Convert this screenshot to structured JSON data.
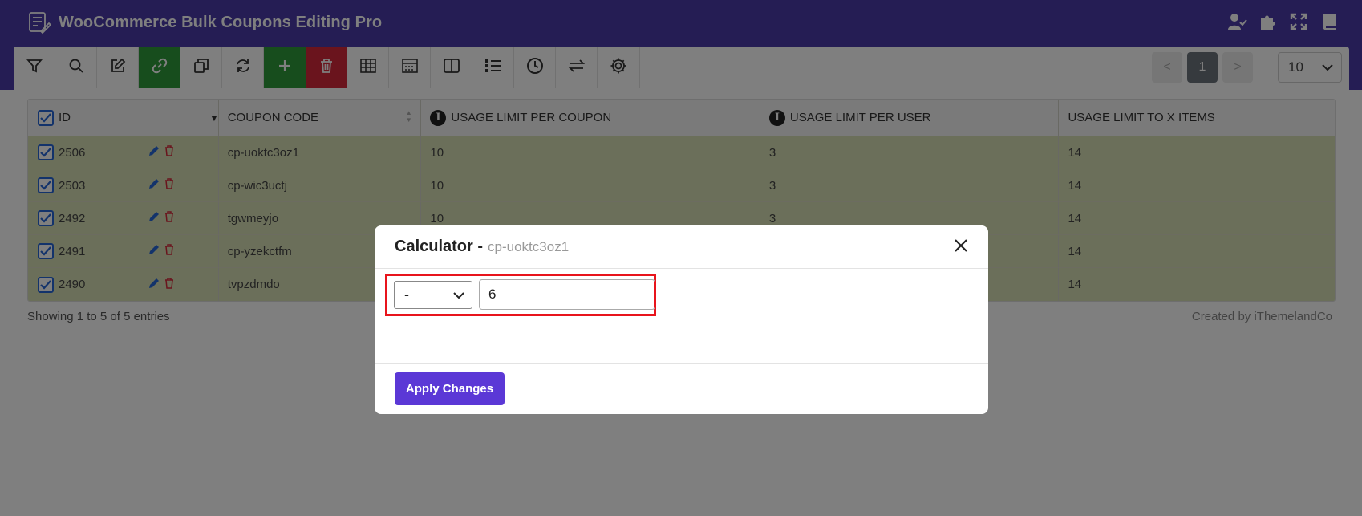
{
  "app": {
    "title": "WooCommerce Bulk Coupons Editing Pro"
  },
  "header_icons": [
    "user-check-icon",
    "puzzle-icon",
    "fullscreen-icon",
    "book-icon"
  ],
  "toolbar": {
    "buttons": [
      {
        "name": "filter-icon"
      },
      {
        "name": "search-icon"
      },
      {
        "name": "edit-icon"
      },
      {
        "name": "link-icon",
        "accent": "#2e9a3a"
      },
      {
        "name": "duplicate-icon"
      },
      {
        "name": "refresh-icon"
      },
      {
        "name": "plus-icon",
        "accent": "#2e9a3a"
      },
      {
        "name": "trash-icon",
        "accent": "#d4293a"
      },
      {
        "name": "table-icon"
      },
      {
        "name": "column-manager-icon"
      },
      {
        "name": "split-view-icon"
      },
      {
        "name": "list-icon"
      },
      {
        "name": "history-icon"
      },
      {
        "name": "swap-icon"
      },
      {
        "name": "settings-icon"
      }
    ]
  },
  "pagination": {
    "prev": "<",
    "current": "1",
    "next": ">",
    "per_page": "10"
  },
  "table": {
    "headers": {
      "id": "ID",
      "coupon_code": "COUPON CODE",
      "usage_limit_per_coupon": "USAGE LIMIT PER COUPON",
      "usage_limit_per_user": "USAGE LIMIT PER USER",
      "usage_limit_to_x_items": "USAGE LIMIT TO X ITEMS"
    },
    "rows": [
      {
        "id": "2506",
        "code": "cp-uoktc3oz1",
        "per_coupon": "10",
        "per_user": "3",
        "x_items": "14"
      },
      {
        "id": "2503",
        "code": "cp-wic3uctj",
        "per_coupon": "10",
        "per_user": "3",
        "x_items": "14"
      },
      {
        "id": "2492",
        "code": "tgwmeyjo",
        "per_coupon": "10",
        "per_user": "3",
        "x_items": "14"
      },
      {
        "id": "2491",
        "code": "cp-yzekctfm",
        "per_coupon": "",
        "per_user": "",
        "x_items": "14"
      },
      {
        "id": "2490",
        "code": "tvpzdmdo",
        "per_coupon": "",
        "per_user": "",
        "x_items": "14"
      }
    ]
  },
  "footer": {
    "showing": "Showing 1 to 5 of 5 entries",
    "credit": "Created by iThemelandCo"
  },
  "modal": {
    "title": "Calculator -",
    "subtitle": "cp-uoktc3oz1",
    "operator": "-",
    "value": "6",
    "apply_label": "Apply Changes"
  },
  "colors": {
    "header": "#4a3aa8",
    "row_highlight": "#d7dfb4",
    "apply_button": "#5b38d6",
    "highlight_border": "#e8141c"
  }
}
